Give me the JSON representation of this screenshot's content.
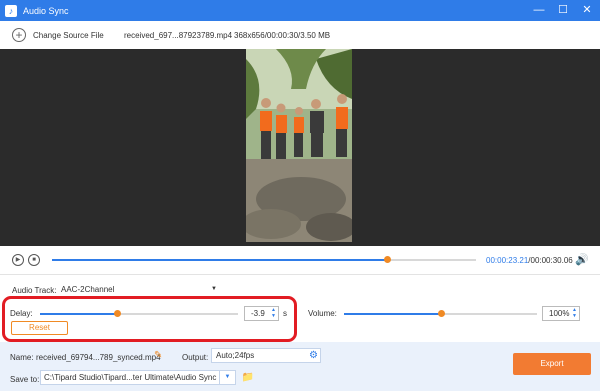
{
  "window": {
    "title": "Audio Sync",
    "minimize": "—",
    "maximize": "☐",
    "close": "✕"
  },
  "toolbar": {
    "change_source": "Change Source File",
    "file_name": "received_697...87923789.mp4",
    "file_info": "368x656/00:00:30/3.50 MB"
  },
  "player": {
    "current_time": "00:00:23.21",
    "total_time": "/00:00:30.06",
    "progress_fraction": 0.79
  },
  "audio_track": {
    "label": "Audio Track:",
    "value": "AAC-2Channel"
  },
  "delay": {
    "label": "Delay:",
    "value": "-3.9",
    "unit": "s",
    "slider_fraction": 0.39,
    "reset_label": "Reset"
  },
  "volume": {
    "label": "Volume:",
    "value": "100%",
    "slider_fraction": 0.5
  },
  "output_bar": {
    "name_label": "Name:",
    "name_value": "received_69794...789_synced.mp4",
    "output_label": "Output:",
    "output_value": "Auto;24fps",
    "save_label": "Save to:",
    "save_path": "C:\\Tipard Studio\\Tipard...ter Ultimate\\Audio Sync",
    "export_label": "Export"
  },
  "colors": {
    "accent": "#2f7ce8",
    "orange": "#f08a24",
    "highlight": "#e21c23"
  }
}
